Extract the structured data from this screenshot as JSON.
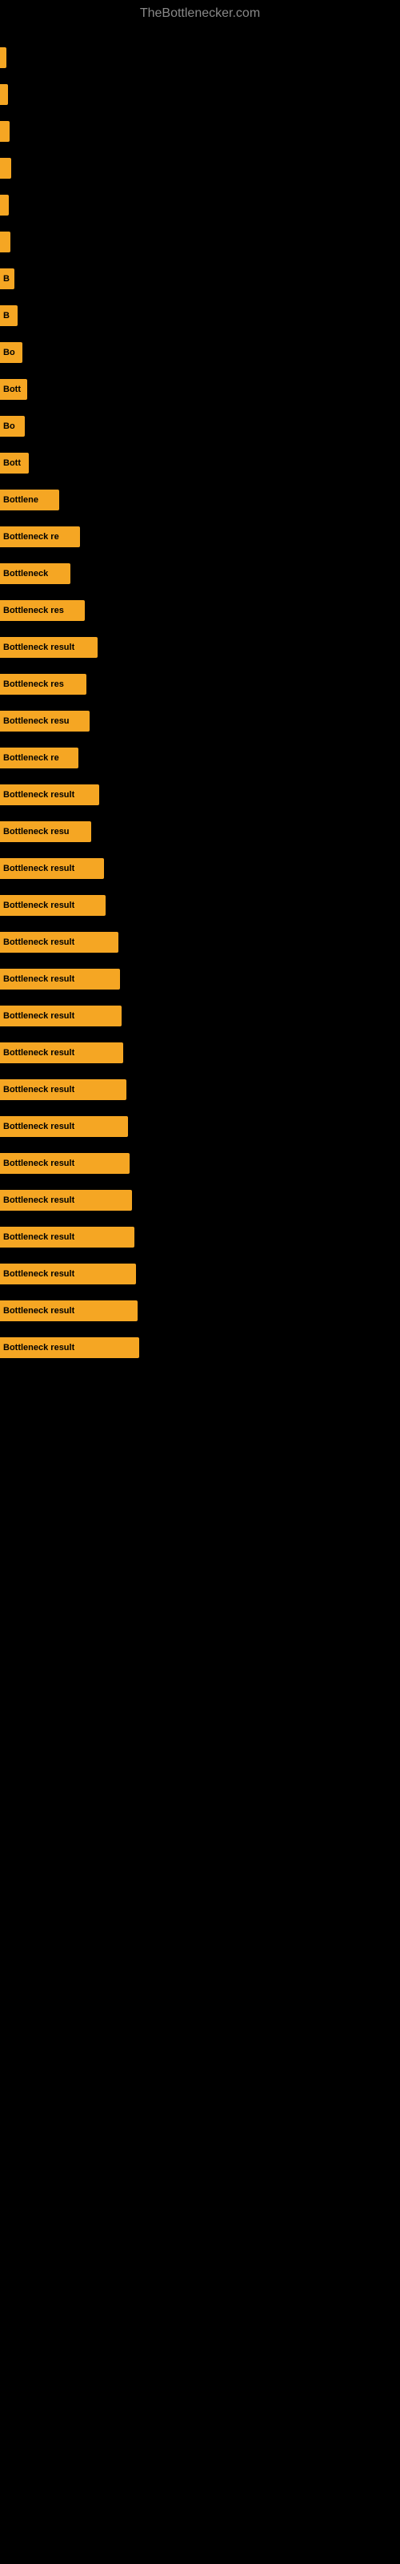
{
  "site": {
    "title": "TheBottlenecker.com"
  },
  "bars": [
    {
      "width": 8,
      "label": ""
    },
    {
      "width": 10,
      "label": ""
    },
    {
      "width": 12,
      "label": ""
    },
    {
      "width": 14,
      "label": ""
    },
    {
      "width": 11,
      "label": ""
    },
    {
      "width": 13,
      "label": ""
    },
    {
      "width": 18,
      "label": "B"
    },
    {
      "width": 22,
      "label": "B"
    },
    {
      "width": 28,
      "label": "Bo"
    },
    {
      "width": 34,
      "label": "Bott"
    },
    {
      "width": 31,
      "label": "Bo"
    },
    {
      "width": 36,
      "label": "Bott"
    },
    {
      "width": 74,
      "label": "Bottlene"
    },
    {
      "width": 100,
      "label": "Bottleneck re"
    },
    {
      "width": 88,
      "label": "Bottleneck"
    },
    {
      "width": 106,
      "label": "Bottleneck res"
    },
    {
      "width": 122,
      "label": "Bottleneck result"
    },
    {
      "width": 108,
      "label": "Bottleneck res"
    },
    {
      "width": 112,
      "label": "Bottleneck resu"
    },
    {
      "width": 98,
      "label": "Bottleneck re"
    },
    {
      "width": 124,
      "label": "Bottleneck result"
    },
    {
      "width": 114,
      "label": "Bottleneck resu"
    },
    {
      "width": 130,
      "label": "Bottleneck result"
    },
    {
      "width": 132,
      "label": "Bottleneck result"
    },
    {
      "width": 148,
      "label": "Bottleneck result"
    },
    {
      "width": 150,
      "label": "Bottleneck result"
    },
    {
      "width": 152,
      "label": "Bottleneck result"
    },
    {
      "width": 154,
      "label": "Bottleneck result"
    },
    {
      "width": 158,
      "label": "Bottleneck result"
    },
    {
      "width": 160,
      "label": "Bottleneck result"
    },
    {
      "width": 162,
      "label": "Bottleneck result"
    },
    {
      "width": 165,
      "label": "Bottleneck result"
    },
    {
      "width": 168,
      "label": "Bottleneck result"
    },
    {
      "width": 170,
      "label": "Bottleneck result"
    },
    {
      "width": 172,
      "label": "Bottleneck result"
    },
    {
      "width": 174,
      "label": "Bottleneck result"
    }
  ]
}
